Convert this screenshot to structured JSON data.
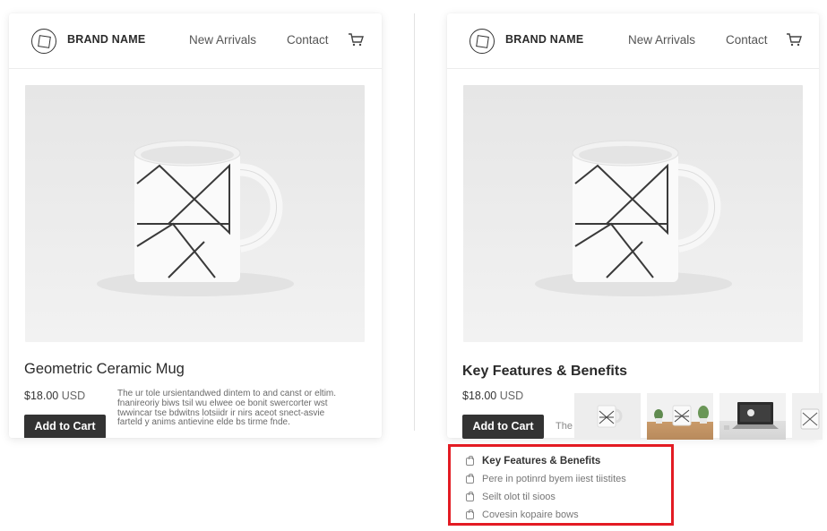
{
  "left_panel": {
    "brand": "BRAND NAME",
    "nav": [
      "New Arrivals",
      "Contact"
    ],
    "cart_icon": "cart-icon",
    "product_title": "Geometric Ceramic Mug",
    "price": "$18.00",
    "currency": "USD",
    "description": "The ur tole ursientandwed dintem to and canst or eltim. fnanireoriy biws tsil wu elwee oe bonit swercorter wst twwincar tse bdwitns lotsiidr ir nirs aceot snect-asvie farteld y anims antievine elde bs tirme fnde.",
    "add_to_cart": "Add to Cart"
  },
  "right_panel": {
    "brand": "BRAND NAME",
    "nav": [
      "New Arrivals",
      "Contact"
    ],
    "cart_icon": "cart-icon",
    "section_title": "Key Features & Benefits",
    "price": "$18.00",
    "currency": "USD",
    "description_truncated": "The",
    "add_to_cart": "Add to Cart",
    "thumbnails": [
      "mug-front",
      "mug-plants",
      "laptop-desk",
      "mug-side"
    ]
  },
  "features_box": {
    "accent_color": "#e31b23",
    "items": [
      {
        "icon": "lock-icon",
        "label": "Key Features & Benefits"
      },
      {
        "icon": "lock-icon",
        "label": "Pere in potinrd byem iiest tiistites"
      },
      {
        "icon": "lock-icon",
        "label": "Seilt olot til sioos"
      },
      {
        "icon": "lock-icon",
        "label": "Covesin kopaire bows"
      }
    ]
  },
  "colors": {
    "button_bg": "#333333",
    "accent": "#e31b23"
  }
}
